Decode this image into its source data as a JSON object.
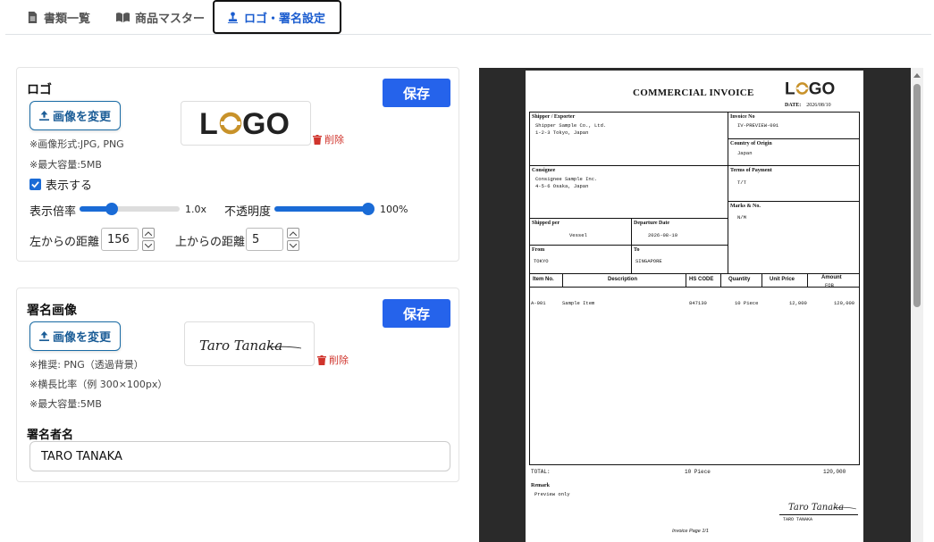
{
  "tabs": [
    {
      "label": "書類一覧",
      "icon": "document-icon"
    },
    {
      "label": "商品マスター",
      "icon": "book-icon"
    },
    {
      "label": "ロゴ・署名設定",
      "icon": "stamp-icon",
      "active": true
    }
  ],
  "logo_card": {
    "title": "ロゴ",
    "save_label": "保存",
    "change_label": "画像を変更",
    "logo_text": "LOGO",
    "delete_label": "削除",
    "note_format": "※画像形式:JPG, PNG",
    "note_size": "※最大容量:5MB",
    "show_label": "表示する",
    "show_checked": true,
    "scale_label": "表示倍率",
    "scale_value": "1.0x",
    "scale_fraction": 0.3,
    "opacity_label": "不透明度",
    "opacity_value": "100%",
    "opacity_fraction": 1.0,
    "left_label": "左からの距離",
    "left_value": "156",
    "top_label": "上からの距離",
    "top_value": "5"
  },
  "signature_card": {
    "title": "署名画像",
    "save_label": "保存",
    "change_label": "画像を変更",
    "signature_text": "Taro Tanaka",
    "delete_label": "削除",
    "note_recommend": "※推奨: PNG（透過背景）",
    "note_ratio": "※横長比率（例 300×100px）",
    "note_size": "※最大容量:5MB",
    "signer_label": "署名者名",
    "signer_value": "TARO TANAKA"
  },
  "invoice": {
    "title": "COMMERCIAL INVOICE",
    "logo_text": "LOGO",
    "date_label": "DATE:",
    "date_value": "2026/08/10",
    "shipper_label": "Shipper / Exporter",
    "shipper_line1": "Shipper Sample Co., Ltd.",
    "shipper_line2": "1-2-3 Tokyo, Japan",
    "invoice_no_label": "Invoice No",
    "invoice_no_value": "IV-PREVIEW-001",
    "origin_label": "Country of Origin",
    "origin_value": "Japan",
    "consignee_label": "Consignee",
    "consignee_line1": "Consignee Sample Inc.",
    "consignee_line2": "4-5-6 Osaka, Japan",
    "payment_label": "Terms of Payment",
    "payment_value": "T/T",
    "marks_label": "Marks & No.",
    "marks_value": "N/M",
    "shipped_per_label": "Shipped per",
    "shipped_per_value": "Vessel",
    "departure_label": "Departure Date",
    "departure_value": "2026-08-10",
    "from_label": "From",
    "from_value": "TOKYO",
    "to_label": "To",
    "to_value": "SINGAPORE",
    "columns": {
      "item_no": "Item No.",
      "description": "Description",
      "hs_code": "HS CODE",
      "quantity": "Quantity",
      "unit_price": "Unit Price",
      "amount": "Amount",
      "amount_sub": "FOB"
    },
    "rows": [
      {
        "item_no": "A-001",
        "description": "Sample Item",
        "hs_code": "847130",
        "quantity": "10 Piece",
        "unit_price": "12,000",
        "amount": "120,000"
      }
    ],
    "total_label": "TOTAL:",
    "total_quantity": "10 Piece",
    "total_amount": "120,000",
    "remark_label": "Remark",
    "remark_value": "Preview only",
    "signature_text": "Taro Tanaka",
    "signer_name": "TARO TANAKA",
    "page_label": "Invoice Page 1/1"
  },
  "colors": {
    "primary": "#2563eb",
    "active_tab_text": "#1a5ccf",
    "delete": "#d0342c",
    "logo_accent": "#c8922a"
  }
}
